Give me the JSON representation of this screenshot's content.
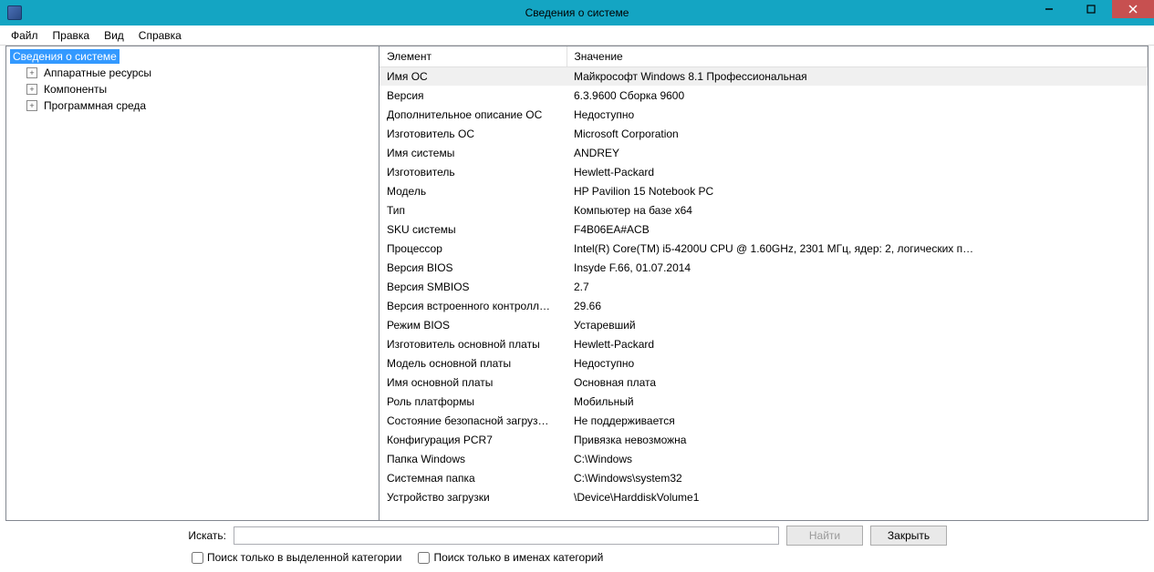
{
  "window": {
    "title": "Сведения о системе"
  },
  "menu": {
    "file": "Файл",
    "edit": "Правка",
    "view": "Вид",
    "help": "Справка"
  },
  "tree": {
    "root": "Сведения о системе",
    "hw": "Аппаратные ресурсы",
    "comp": "Компоненты",
    "sw": "Программная среда"
  },
  "columns": {
    "element": "Элемент",
    "value": "Значение"
  },
  "rows": [
    {
      "k": "Имя ОС",
      "v": "Майкрософт Windows 8.1 Профессиональная"
    },
    {
      "k": "Версия",
      "v": "6.3.9600 Сборка 9600"
    },
    {
      "k": "Дополнительное описание ОС",
      "v": "Недоступно"
    },
    {
      "k": "Изготовитель ОС",
      "v": "Microsoft Corporation"
    },
    {
      "k": "Имя системы",
      "v": "ANDREY"
    },
    {
      "k": "Изготовитель",
      "v": "Hewlett-Packard"
    },
    {
      "k": "Модель",
      "v": "HP Pavilion 15 Notebook PC"
    },
    {
      "k": "Тип",
      "v": "Компьютер на базе x64"
    },
    {
      "k": "SKU системы",
      "v": "F4B06EA#ACB"
    },
    {
      "k": "Процессор",
      "v": "Intel(R) Core(TM) i5-4200U CPU @ 1.60GHz, 2301 МГц, ядер: 2, логических п…"
    },
    {
      "k": "Версия BIOS",
      "v": "Insyde F.66, 01.07.2014"
    },
    {
      "k": "Версия SMBIOS",
      "v": "2.7"
    },
    {
      "k": "Версия встроенного контролл…",
      "v": "29.66"
    },
    {
      "k": "Режим BIOS",
      "v": "Устаревший"
    },
    {
      "k": "Изготовитель основной платы",
      "v": "Hewlett-Packard"
    },
    {
      "k": "Модель основной платы",
      "v": "Недоступно"
    },
    {
      "k": "Имя основной платы",
      "v": "Основная плата"
    },
    {
      "k": "Роль платформы",
      "v": "Мобильный"
    },
    {
      "k": "Состояние безопасной загруз…",
      "v": "Не поддерживается"
    },
    {
      "k": "Конфигурация PCR7",
      "v": "Привязка невозможна"
    },
    {
      "k": "Папка Windows",
      "v": "C:\\Windows"
    },
    {
      "k": "Системная папка",
      "v": "C:\\Windows\\system32"
    },
    {
      "k": "Устройство загрузки",
      "v": "\\Device\\HarddiskVolume1"
    }
  ],
  "footer": {
    "search_label": "Искать:",
    "search_value": "",
    "find": "Найти",
    "close": "Закрыть",
    "chk_category": "Поиск только в выделенной категории",
    "chk_names": "Поиск только в именах категорий"
  }
}
